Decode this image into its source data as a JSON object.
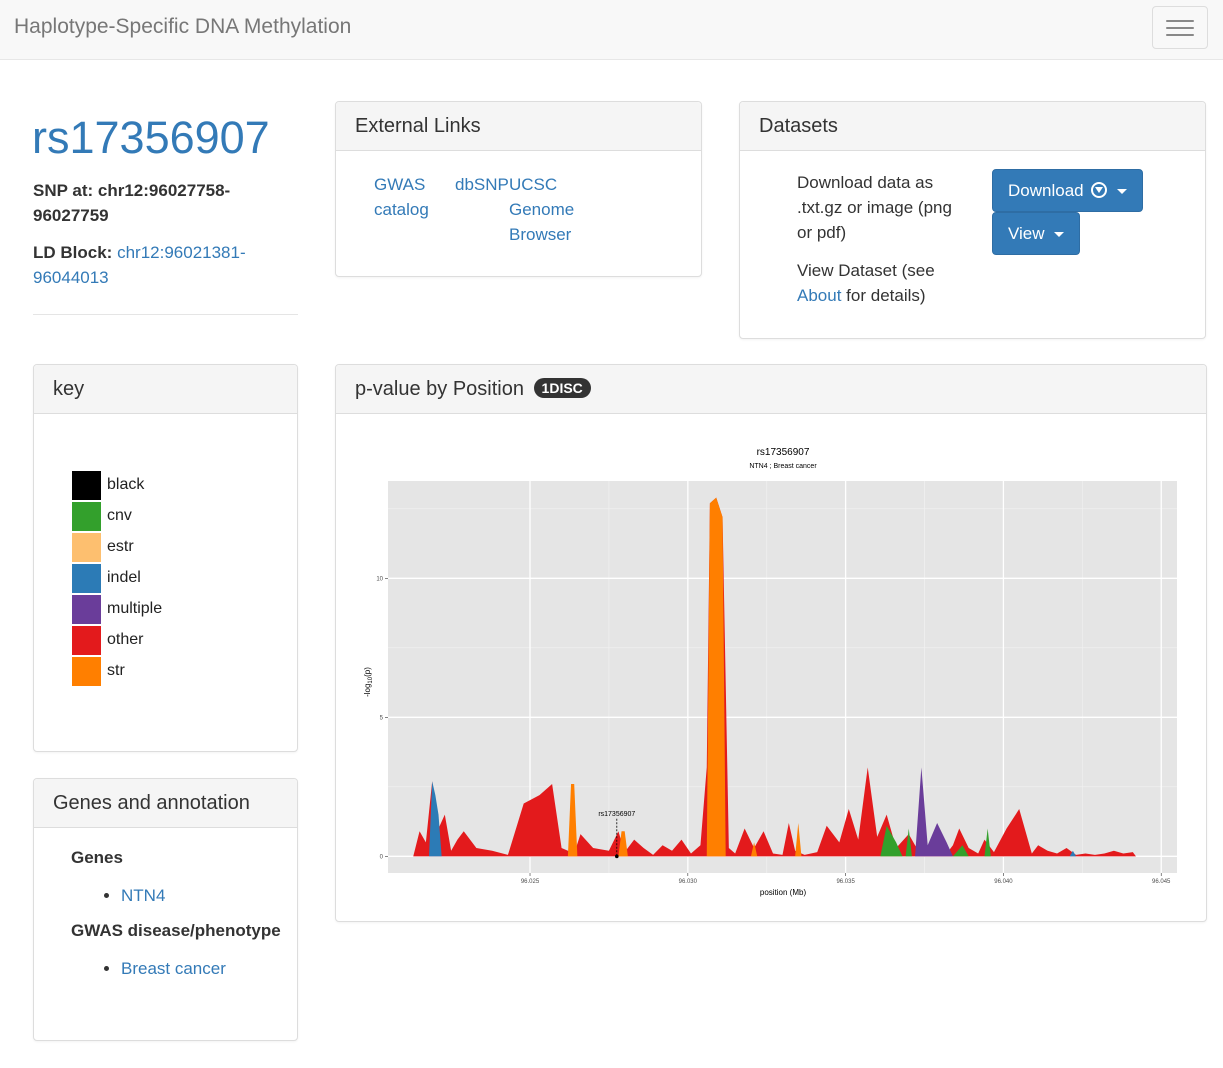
{
  "navbar": {
    "brand": "Haplotype-Specific DNA Methylation",
    "menu_icon": "hamburger-menu-icon"
  },
  "snp": {
    "id": "rs17356907",
    "position_label": "SNP at:",
    "position_value": "chr12:96027758-96027759",
    "ld_label": "LD Block:",
    "ld_value": "chr12:96021381-96044013"
  },
  "external_links": {
    "title": "External Links",
    "gwas": "GWAS catalog",
    "dbsnp": "dbSNP",
    "ucsc": "UCSC Genome Browser"
  },
  "datasets": {
    "title": "Datasets",
    "download_text": "Download data as .txt.gz or image (png or pdf)",
    "view_text_before": "View Dataset (see",
    "view_link": "About",
    "view_text_after": "for details)",
    "download_button": "Download",
    "view_button": "View"
  },
  "key": {
    "title": "key",
    "items": [
      {
        "label": "black",
        "color": "#000000"
      },
      {
        "label": "cnv",
        "color": "#33a02c"
      },
      {
        "label": "estr",
        "color": "#fdbf6f"
      },
      {
        "label": "indel",
        "color": "#2c7bb6"
      },
      {
        "label": "multiple",
        "color": "#6a3d9a"
      },
      {
        "label": "other",
        "color": "#e31a1c"
      },
      {
        "label": "str",
        "color": "#ff7f00"
      }
    ]
  },
  "plot_panel": {
    "title": "p-value by Position",
    "badge": "1DISC"
  },
  "genes": {
    "title": "Genes and annotation",
    "genes_heading": "Genes",
    "genes": [
      "NTN4"
    ],
    "gwas_heading": "GWAS disease/phenotype",
    "gwas": [
      "Breast cancer"
    ]
  },
  "chart_data": {
    "type": "area",
    "title": "rs17356907",
    "subtitle": "NTN4 ; Breast cancer",
    "xlabel": "position (Mb)",
    "ylabel": "-log10(p)",
    "xlim": [
      96.0205,
      96.0455
    ],
    "ylim": [
      -0.6,
      13.5
    ],
    "x_ticks": [
      "96.025",
      "96.030",
      "96.035",
      "96.040",
      "96.045"
    ],
    "x_tick_values": [
      96.025,
      96.03,
      96.035,
      96.04,
      96.045
    ],
    "y_ticks": [
      "0",
      "5",
      "10"
    ],
    "y_tick_values": [
      0,
      5,
      10
    ],
    "annotation": {
      "label": "rs17356907",
      "x": 96.02775,
      "y": 0
    },
    "background": "#e5e5e5",
    "grid": true,
    "profile": {
      "x": [
        96.0213,
        96.0215,
        96.0217,
        96.0219,
        96.0221,
        96.0223,
        96.0225,
        96.0227,
        96.0229,
        96.0233,
        96.0238,
        96.0243,
        96.0248,
        96.0253,
        96.0257,
        96.026,
        96.0262,
        96.0264,
        96.0266,
        96.027,
        96.0275,
        96.0278,
        96.028,
        96.0283,
        96.0286,
        96.0289,
        96.0292,
        96.0295,
        96.0298,
        96.0301,
        96.0304,
        96.0306,
        96.0307,
        96.0309,
        96.0311,
        96.0313,
        96.0315,
        96.0318,
        96.0321,
        96.0324,
        96.0327,
        96.033,
        96.0332,
        96.0334,
        96.0337,
        96.0341,
        96.0344,
        96.0348,
        96.0351,
        96.0354,
        96.0357,
        96.036,
        96.0363,
        96.0366,
        96.037,
        96.0372,
        96.0374,
        96.0376,
        96.0379,
        96.0382,
        96.0384,
        96.0386,
        96.0389,
        96.0392,
        96.0394,
        96.0397,
        96.0401,
        96.0405,
        96.0409,
        96.0411,
        96.0414,
        96.0417,
        96.042,
        96.0423,
        96.0426,
        96.0429,
        96.0432,
        96.0435,
        96.0438,
        96.0441,
        96.0442
      ],
      "y": [
        0,
        0.9,
        0.5,
        2.7,
        1.0,
        1.5,
        0.2,
        0.6,
        0.9,
        0.3,
        0.2,
        0.05,
        1.9,
        2.2,
        2.6,
        0.3,
        0.2,
        0.1,
        0.8,
        0.3,
        0.2,
        0.9,
        0.15,
        0.6,
        0.3,
        0.05,
        0.4,
        0.2,
        0.6,
        0.1,
        0.4,
        3.2,
        12.7,
        12.9,
        12.2,
        0.3,
        0.1,
        1.0,
        0.3,
        0.9,
        0.1,
        0.05,
        1.2,
        0.2,
        0.05,
        0.15,
        1.1,
        0.5,
        1.7,
        0.6,
        3.2,
        0.7,
        1.5,
        0.3,
        0.8,
        0.4,
        0.1,
        0.3,
        0.5,
        0.1,
        0.4,
        1.0,
        0.3,
        0.1,
        0.6,
        0.15,
        1.0,
        1.7,
        0.1,
        0.4,
        0.2,
        0.1,
        0.3,
        0.05,
        0.1,
        0.05,
        0.1,
        0.2,
        0.1,
        0.15,
        0
      ],
      "color": "#e31a1c"
    },
    "series": [
      {
        "name": "indel",
        "color": "#2c7bb6",
        "x": [
          96.0218,
          96.0219,
          96.022,
          96.0221,
          96.0222
        ],
        "y": [
          0,
          2.7,
          2.2,
          1.5,
          0
        ]
      },
      {
        "name": "str",
        "color": "#ff7f00",
        "x": [
          96.0262,
          96.0263,
          96.0264,
          96.0265
        ],
        "y": [
          0,
          2.6,
          2.6,
          0
        ]
      },
      {
        "name": "str",
        "color": "#ff7f00",
        "x": [
          96.0278,
          96.0279,
          96.028,
          96.0281
        ],
        "y": [
          0,
          0.9,
          0.9,
          0
        ]
      },
      {
        "name": "str",
        "color": "#ff7f00",
        "x": [
          96.0306,
          96.0307,
          96.0309,
          96.0311,
          96.0312
        ],
        "y": [
          0,
          12.7,
          12.9,
          12.2,
          0
        ]
      },
      {
        "name": "str",
        "color": "#ff7f00",
        "x": [
          96.032,
          96.0321,
          96.0322
        ],
        "y": [
          0,
          0.5,
          0
        ]
      },
      {
        "name": "str",
        "color": "#ff7f00",
        "x": [
          96.0334,
          96.0335,
          96.0336
        ],
        "y": [
          0,
          1.2,
          0
        ]
      },
      {
        "name": "cnv",
        "color": "#33a02c",
        "x": [
          96.0361,
          96.0363,
          96.0366,
          96.0368
        ],
        "y": [
          0,
          1.1,
          0.5,
          0
        ]
      },
      {
        "name": "cnv",
        "color": "#33a02c",
        "x": [
          96.0369,
          96.037,
          96.0371
        ],
        "y": [
          0,
          1.0,
          0
        ]
      },
      {
        "name": "multiple",
        "color": "#6a3d9a",
        "x": [
          96.0372,
          96.0374,
          96.0376,
          96.0379,
          96.0382,
          96.0384
        ],
        "y": [
          0,
          3.2,
          0.4,
          1.2,
          0.5,
          0
        ]
      },
      {
        "name": "cnv",
        "color": "#33a02c",
        "x": [
          96.0384,
          96.0387,
          96.0389
        ],
        "y": [
          0,
          0.4,
          0
        ]
      },
      {
        "name": "cnv",
        "color": "#33a02c",
        "x": [
          96.0394,
          96.0395,
          96.0396
        ],
        "y": [
          0,
          1.0,
          0
        ]
      },
      {
        "name": "indel",
        "color": "#2c7bb6",
        "x": [
          96.0421,
          96.0422,
          96.0423
        ],
        "y": [
          0,
          0.2,
          0
        ]
      }
    ]
  }
}
